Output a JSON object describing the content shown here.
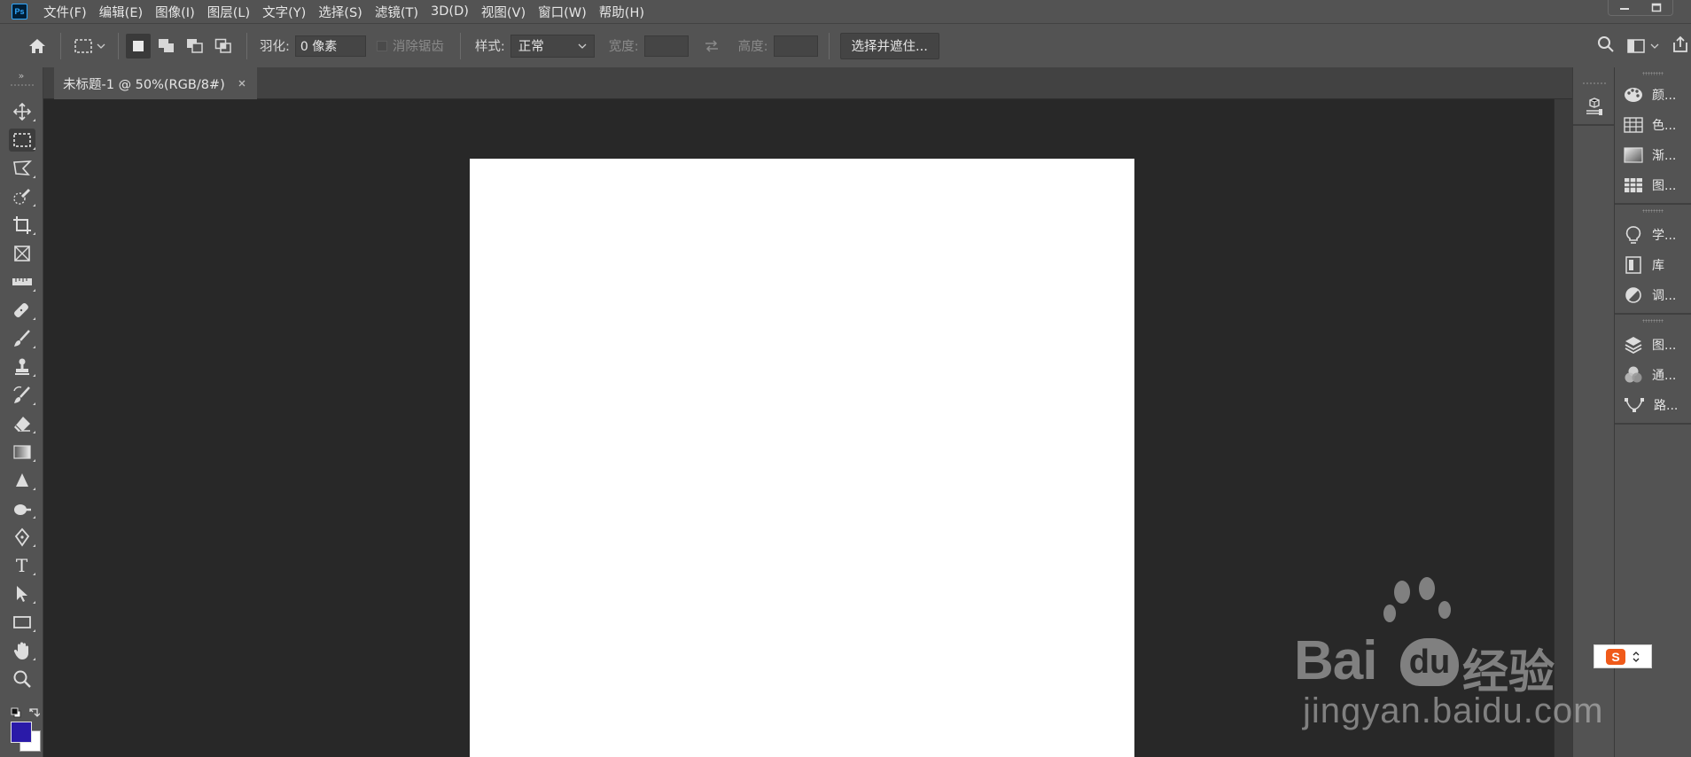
{
  "app": {
    "logo_text": "Ps",
    "accent": "#31a8ff"
  },
  "menu": [
    {
      "label": "文件(F)"
    },
    {
      "label": "编辑(E)"
    },
    {
      "label": "图像(I)"
    },
    {
      "label": "图层(L)"
    },
    {
      "label": "文字(Y)"
    },
    {
      "label": "选择(S)"
    },
    {
      "label": "滤镜(T)"
    },
    {
      "label": "3D(D)"
    },
    {
      "label": "视图(V)"
    },
    {
      "label": "窗口(W)"
    },
    {
      "label": "帮助(H)"
    }
  ],
  "options": {
    "feather_label": "羽化:",
    "feather_value": "0 像素",
    "antialias_label": "消除锯齿",
    "style_label": "样式:",
    "style_value": "正常",
    "width_label": "宽度:",
    "height_label": "高度:",
    "select_mask_button": "选择并遮住..."
  },
  "document": {
    "tab_title": "未标题-1 @ 50%(RGB/8#)",
    "canvas_color": "#ffffff"
  },
  "tools": [
    {
      "name": "move-tool",
      "icon": "move-icon"
    },
    {
      "name": "marquee-tool",
      "icon": "rect-marquee-icon",
      "active": true
    },
    {
      "name": "lasso-tool",
      "icon": "polygon-lasso-icon"
    },
    {
      "name": "quick-select-tool",
      "icon": "quick-select-icon"
    },
    {
      "name": "crop-tool",
      "icon": "crop-icon"
    },
    {
      "name": "frame-tool",
      "icon": "frame-icon"
    },
    {
      "name": "ruler-tool",
      "icon": "ruler-icon"
    },
    {
      "name": "healing-tool",
      "icon": "bandage-icon"
    },
    {
      "name": "brush-tool",
      "icon": "brush-icon"
    },
    {
      "name": "stamp-tool",
      "icon": "stamp-icon"
    },
    {
      "name": "history-brush-tool",
      "icon": "history-brush-icon"
    },
    {
      "name": "eraser-tool",
      "icon": "eraser-icon"
    },
    {
      "name": "gradient-tool",
      "icon": "gradient-icon"
    },
    {
      "name": "blur-tool",
      "icon": "blur-icon"
    },
    {
      "name": "dodge-tool",
      "icon": "dodge-icon"
    },
    {
      "name": "pen-tool",
      "icon": "pen-icon"
    },
    {
      "name": "type-tool",
      "icon": "type-icon",
      "glyph": "T"
    },
    {
      "name": "path-select-tool",
      "icon": "arrow-icon"
    },
    {
      "name": "rectangle-tool",
      "icon": "rectangle-icon"
    },
    {
      "name": "hand-tool",
      "icon": "hand-icon"
    },
    {
      "name": "zoom-tool",
      "icon": "zoom-icon"
    }
  ],
  "colors": {
    "foreground": "#2a1aa8",
    "background": "#ffffff"
  },
  "panels": {
    "group1": [
      {
        "label": "颜...",
        "icon": "palette-icon"
      },
      {
        "label": "色...",
        "icon": "swatches-icon"
      },
      {
        "label": "渐...",
        "icon": "gradient-panel-icon"
      },
      {
        "label": "图...",
        "icon": "pattern-icon"
      }
    ],
    "group2": [
      {
        "label": "学...",
        "icon": "lightbulb-icon"
      },
      {
        "label": "库",
        "icon": "library-icon"
      },
      {
        "label": "调...",
        "icon": "adjustments-icon"
      }
    ],
    "group3": [
      {
        "label": "图...",
        "icon": "layers-icon"
      },
      {
        "label": "通...",
        "icon": "channels-icon"
      },
      {
        "label": "路...",
        "icon": "paths-icon"
      }
    ]
  },
  "watermark": {
    "brand": "Bai",
    "brand_du": "du",
    "brand_cn": "经验",
    "url": "jingyan.baidu.com"
  },
  "ime": {
    "logo": "S"
  }
}
